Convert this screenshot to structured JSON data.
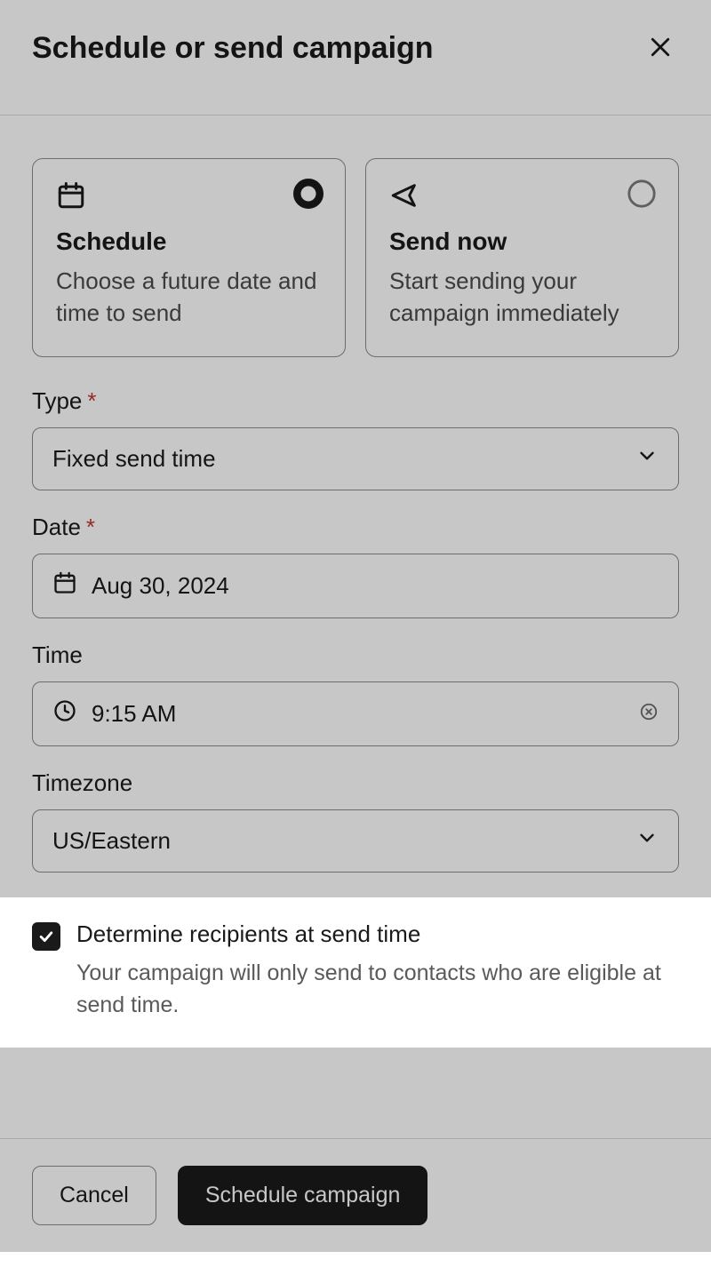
{
  "header": {
    "title": "Schedule or send campaign"
  },
  "options": {
    "schedule": {
      "title": "Schedule",
      "desc": "Choose a future date and time to send",
      "selected": true
    },
    "send_now": {
      "title": "Send now",
      "desc": "Start sending your campaign immediately",
      "selected": false
    }
  },
  "fields": {
    "type": {
      "label": "Type",
      "value": "Fixed send time"
    },
    "date": {
      "label": "Date",
      "value": "Aug 30, 2024"
    },
    "time": {
      "label": "Time",
      "value": "9:15 AM"
    },
    "timezone": {
      "label": "Timezone",
      "value": "US/Eastern"
    }
  },
  "checkbox": {
    "label": "Determine recipients at send time",
    "desc": "Your campaign will only send to contacts who are eligible at send time.",
    "checked": true
  },
  "footer": {
    "cancel": "Cancel",
    "submit": "Schedule campaign"
  }
}
